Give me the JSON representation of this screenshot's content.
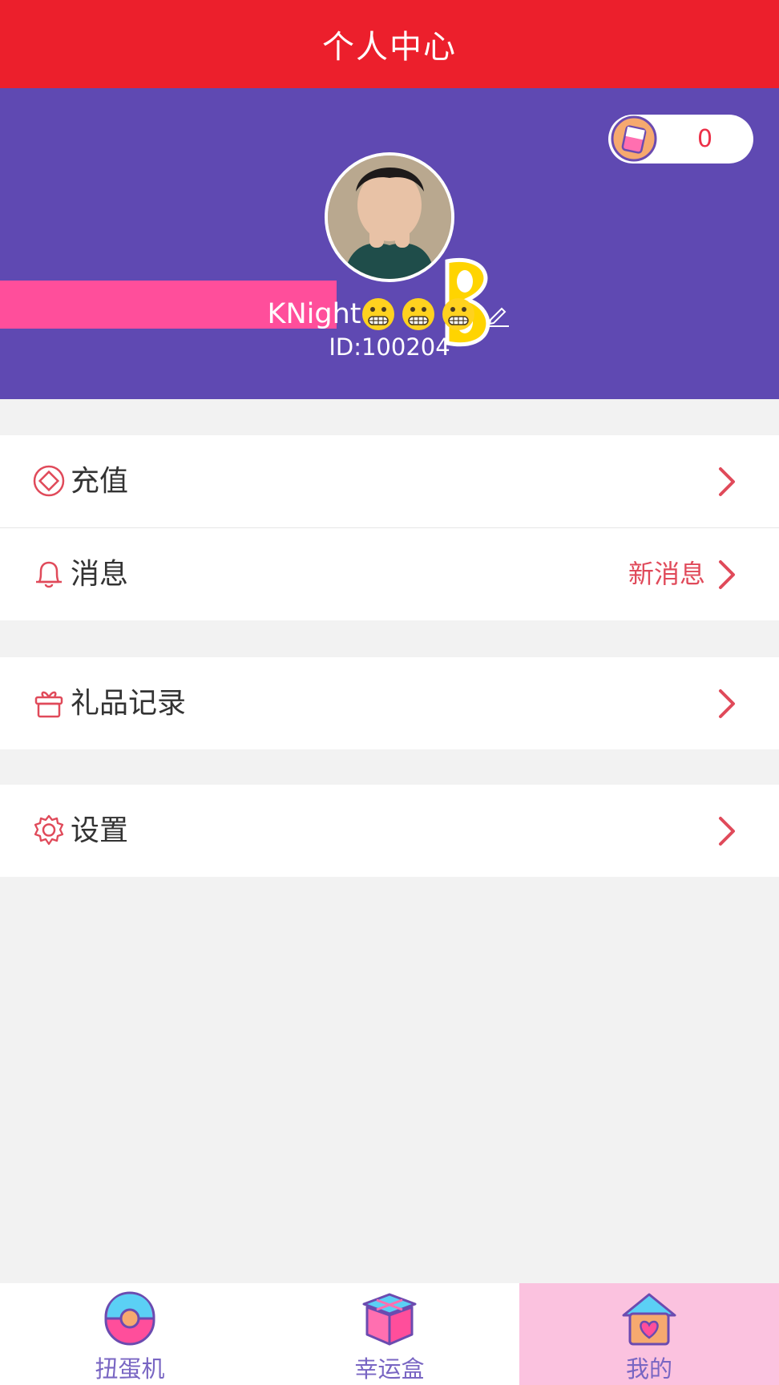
{
  "header": {
    "title": "个人中心"
  },
  "profile": {
    "coins": "0",
    "username": "KNight",
    "emoji_count": 3,
    "user_id": "ID:100204"
  },
  "menu": {
    "recharge": {
      "label": "充值",
      "icon": "recharge-icon"
    },
    "messages": {
      "label": "消息",
      "badge": "新消息",
      "icon": "bell-icon"
    },
    "gift_records": {
      "label": "礼品记录",
      "icon": "gift-icon"
    },
    "settings": {
      "label": "设置",
      "icon": "gear-icon"
    }
  },
  "tabs": [
    {
      "label": "扭蛋机",
      "icon": "capsule-machine-icon",
      "active": false
    },
    {
      "label": "幸运盒",
      "icon": "lucky-box-icon",
      "active": false
    },
    {
      "label": "我的",
      "icon": "home-heart-icon",
      "active": true
    }
  ],
  "colors": {
    "header_red": "#ec1f2c",
    "hero_purple": "#5f49b2",
    "accent_pink": "#ff4e9b",
    "menu_icon_red": "#e04a5a",
    "tab_text_purple": "#7966c3",
    "active_tab_bg": "#fbc2df"
  }
}
